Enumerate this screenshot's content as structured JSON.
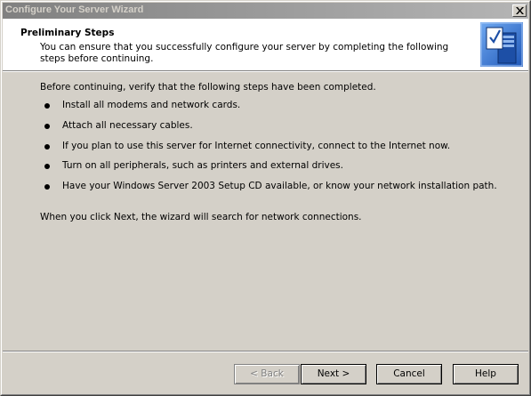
{
  "window": {
    "title": "Configure Your Server Wizard",
    "close_symbol": "×"
  },
  "header": {
    "title": "Preliminary Steps",
    "description": "You can ensure that you successfully configure your server by completing the following steps before continuing.",
    "icon": "server-checklist-icon"
  },
  "content": {
    "intro": "Before continuing, verify that the following steps have been completed.",
    "steps": [
      "Install all modems and network cards.",
      "Attach all necessary cables.",
      "If you plan to use this server for Internet connectivity, connect to the Internet now.",
      "Turn on all peripherals, such as printers and external drives.",
      "Have your Windows Server 2003 Setup CD available, or know your network installation path."
    ],
    "outro": "When you click Next, the wizard will search for network connections."
  },
  "buttons": {
    "back": "< Back",
    "next": "Next >",
    "cancel": "Cancel",
    "help": "Help"
  },
  "colors": {
    "face": "#d4d0c8",
    "titlebar_start": "#808080",
    "titlebar_end": "#b5b5b5",
    "header_bg": "#ffffff",
    "icon_blue": "#2d6fd1"
  }
}
